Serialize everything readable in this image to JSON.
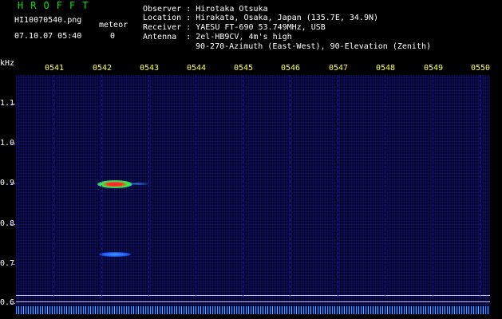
{
  "header": {
    "title": "HROFFT",
    "filename": "HI10070540.png",
    "datetime": "07.10.07 05:40",
    "meteor_label": "meteor",
    "meteor_count": "0",
    "observer_label": "Observer : ",
    "observer": "Hirotaka Otsuka",
    "location_label": "Location : ",
    "location": "Hirakata, Osaka, Japan (135.7E, 34.9N)",
    "receiver_label": "Receiver : ",
    "receiver": "YAESU FT-690 53.749MHz, USB",
    "antenna_label": "Antenna  : ",
    "antenna": "2el-HB9CV, 4m's high",
    "antenna_line2": "90-270-Azimuth (East-West), 90-Elevation (Zenith)"
  },
  "axis": {
    "unit": "kHz",
    "time_ticks": [
      "0541",
      "0542",
      "0543",
      "0544",
      "0545",
      "0546",
      "0547",
      "0548",
      "0549",
      "0550"
    ],
    "freq_ticks": [
      "1.1",
      "1.0",
      "0.9",
      "0.8",
      "0.7",
      "0.6"
    ]
  },
  "colors": {
    "title": "#00e000",
    "time_ticks": "#ffff50",
    "background": "#050530",
    "echo_hot": "#ff2020",
    "echo_warm": "#30ff30",
    "echo_cool": "#2080ff"
  }
}
